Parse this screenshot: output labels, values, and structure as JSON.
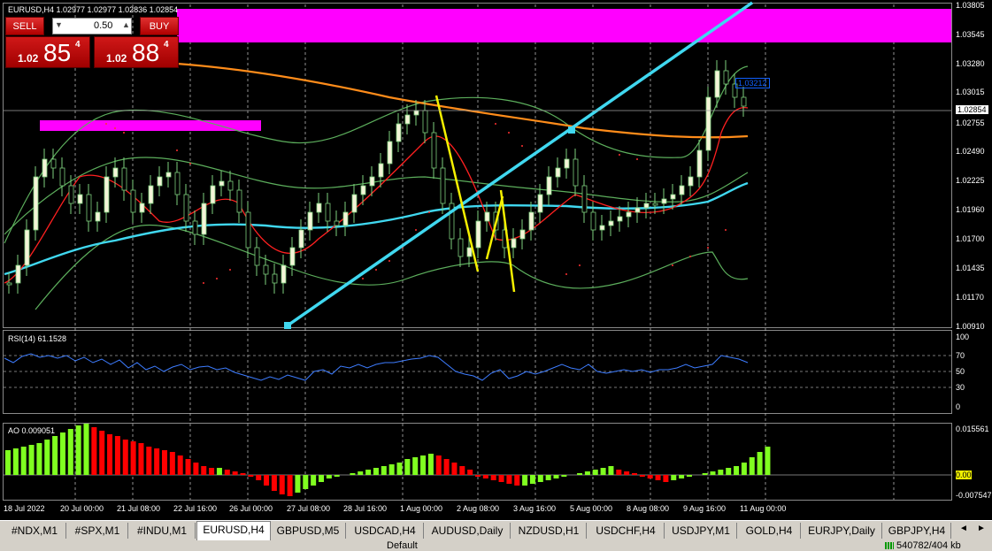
{
  "symbol_header": "EURUSD,H4  1.02977 1.02977 1.02836 1.02854",
  "trade_panel": {
    "sell_label": "SELL",
    "buy_label": "BUY",
    "lot_value": "0.50",
    "sell_price": {
      "prefix": "1.02",
      "big": "85",
      "sup": "4"
    },
    "buy_price": {
      "prefix": "1.02",
      "big": "88",
      "sup": "4"
    }
  },
  "price_axis": [
    "1.03805",
    "1.03545",
    "1.03280",
    "1.03015",
    "1.02755",
    "1.02490",
    "1.02225",
    "1.01960",
    "1.01700",
    "1.01435",
    "1.01170",
    "1.00910"
  ],
  "current_price_label": "1.02854",
  "pending_price_label": "1.03212",
  "rsi": {
    "title": "RSI(14) 61.1528",
    "levels": [
      "100",
      "70",
      "50",
      "30",
      "0"
    ]
  },
  "ao": {
    "title": "AO 0.009051",
    "levels": [
      "0.015561",
      "0.00",
      "-0.007547"
    ]
  },
  "time_axis": [
    "18 Jul 2022",
    "20 Jul 00:00",
    "21 Jul 08:00",
    "22 Jul 16:00",
    "26 Jul 00:00",
    "27 Jul 08:00",
    "28 Jul 16:00",
    "1 Aug 00:00",
    "2 Aug 08:00",
    "3 Aug 16:00",
    "5 Aug 00:00",
    "8 Aug 08:00",
    "9 Aug 16:00",
    "11 Aug 00:00"
  ],
  "tabs": [
    "#NDX,M1",
    "#SPX,M1",
    "#INDU,M1",
    "EURUSD,H4",
    "GBPUSD,M5",
    "USDCAD,H4",
    "AUDUSD,Daily",
    "NZDUSD,H1",
    "USDCHF,H4",
    "USDJPY,M1",
    "GOLD,H4",
    "EURJPY,Daily",
    "GBPJPY,H4"
  ],
  "active_tab": "EURUSD,H4",
  "status": {
    "profile": "Default",
    "traffic": "540782/404 kb"
  },
  "colors": {
    "bull_ao": "#80ff20",
    "bear_ao": "#ff0000",
    "trend": "#40d8f0",
    "zone": "#ff00ff",
    "sma": "#ff8c1a"
  }
}
